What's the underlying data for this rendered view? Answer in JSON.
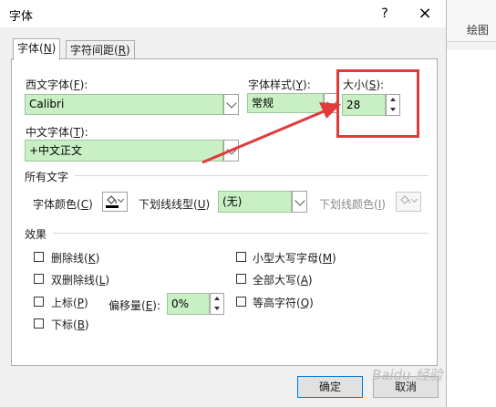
{
  "background": {
    "ribbon_label": "绘图"
  },
  "dialog": {
    "title": "字体",
    "help_label": "?",
    "close_label": "×",
    "tabs": [
      {
        "label_main": "字体(",
        "label_key": "N",
        "label_end": ")"
      },
      {
        "label_main": "字符间距(",
        "label_key": "R",
        "label_end": ")"
      }
    ]
  },
  "western_font": {
    "label_main": "西文字体(",
    "label_key": "F",
    "label_end": "):",
    "value": "Calibri"
  },
  "font_style": {
    "label_main": "字体样式(",
    "label_key": "Y",
    "label_end": "):",
    "value": "常规"
  },
  "font_size": {
    "label_main": "大小(",
    "label_key": "S",
    "label_end": "):",
    "value": "28"
  },
  "chinese_font": {
    "label_main": "中文字体(",
    "label_key": "T",
    "label_end": "):",
    "value": "+中文正文"
  },
  "all_text": {
    "section_label": "所有文字",
    "font_color": {
      "label_main": "字体颜色(",
      "label_key": "C",
      "label_end": ")"
    },
    "underline_style": {
      "label_main": "下划线线型(",
      "label_key": "U",
      "label_end": ")",
      "value": "(无)"
    },
    "underline_color": {
      "label_main": "下划线颜色(",
      "label_key": "I",
      "label_end": ")"
    }
  },
  "effects": {
    "section_label": "效果",
    "strikethrough": {
      "label_main": "删除线(",
      "label_key": "K",
      "label_end": ")"
    },
    "double_strikethrough": {
      "label_main": "双删除线(",
      "label_key": "L",
      "label_end": ")"
    },
    "superscript": {
      "label_main": "上标(",
      "label_key": "P",
      "label_end": ")"
    },
    "subscript": {
      "label_main": "下标(",
      "label_key": "B",
      "label_end": ")"
    },
    "offset": {
      "label_main": "偏移量(",
      "label_key": "E",
      "label_end": "):",
      "value": "0%"
    },
    "small_caps": {
      "label_main": "小型大写字母(",
      "label_key": "M",
      "label_end": ")"
    },
    "all_caps": {
      "label_main": "全部大写(",
      "label_key": "A",
      "label_end": ")"
    },
    "equal_height": {
      "label_main": "等高字符(",
      "label_key": "Q",
      "label_end": ")"
    }
  },
  "buttons": {
    "ok": "确定",
    "cancel": "取消"
  },
  "watermark": "Baidu 经验",
  "colors": {
    "field_green": "#c9f0c4",
    "annotation_red": "#e03a3a",
    "accent": "#0078d7"
  }
}
